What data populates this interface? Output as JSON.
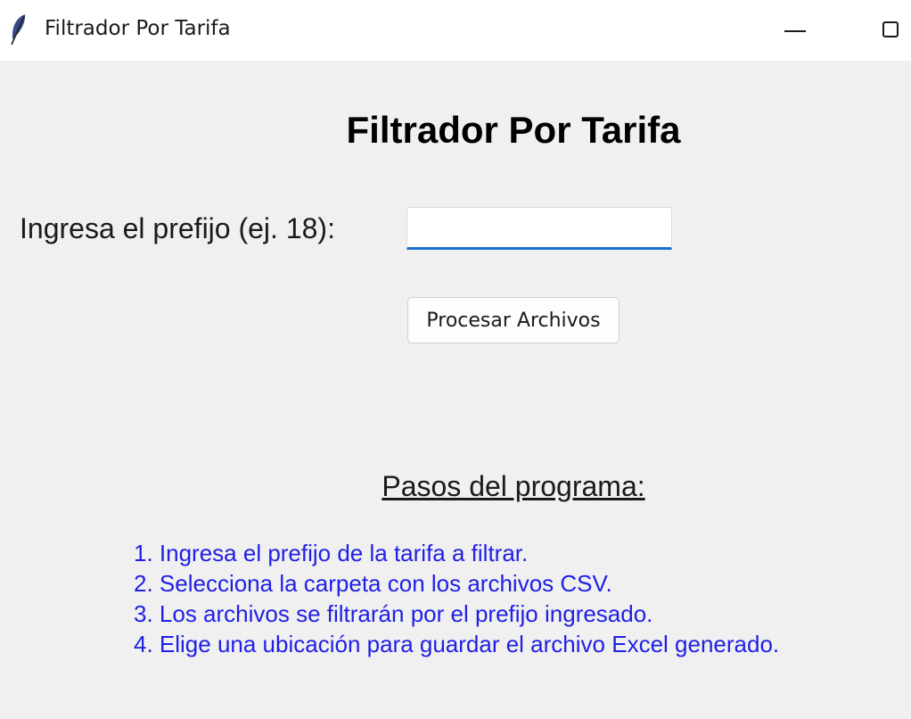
{
  "window": {
    "title": "Filtrador Por Tarifa",
    "icon": "feather-icon"
  },
  "main": {
    "heading": "Filtrador Por Tarifa",
    "prefix_label": "Ingresa el prefijo (ej. 18):",
    "prefix_value": "",
    "process_button": "Procesar Archivos",
    "steps_heading": "Pasos del programa:",
    "steps": [
      "1. Ingresa el prefijo de la tarifa a filtrar.",
      "2. Selecciona la carpeta con los archivos CSV.",
      "3. Los archivos se filtrarán por el prefijo ingresado.",
      "4. Elige una ubicación para guardar el archivo Excel generado."
    ]
  },
  "colors": {
    "steps_text": "#1f1fe6",
    "input_focus": "#1a6fcf",
    "background": "#f0f0f0"
  }
}
